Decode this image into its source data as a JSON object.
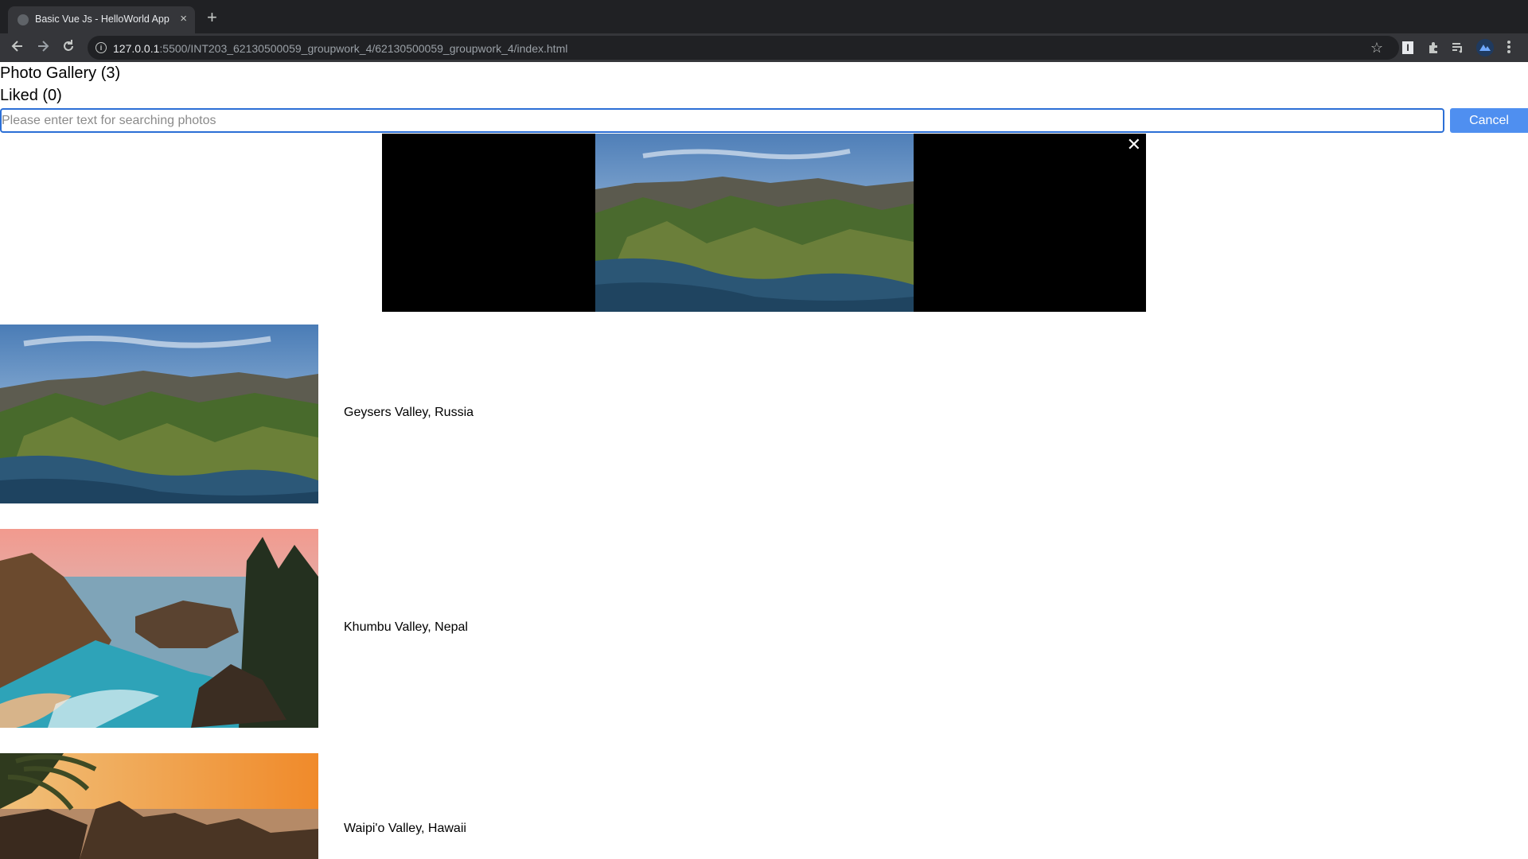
{
  "browser": {
    "tab_title": "Basic Vue Js - HelloWorld App",
    "tab_close": "×",
    "new_tab": "+",
    "url_host": "127.0.0.1",
    "url_path": ":5500/INT203_62130500059_groupwork_4/62130500059_groupwork_4/index.html",
    "icons": [
      "back-icon",
      "forward-icon",
      "reload-icon",
      "info-icon",
      "star-icon",
      "extension-icon",
      "puzzle-icon",
      "reading-list-icon",
      "avatar",
      "menu-icon"
    ]
  },
  "page": {
    "gallery_heading": "Photo Gallery (3)",
    "liked_heading": "Liked (0)",
    "search": {
      "value": "",
      "placeholder": "Please enter text for searching photos"
    },
    "cancel_label": "Cancel",
    "viewer": {
      "close_label": "✕",
      "photo": "big-sur-coast"
    },
    "photos": [
      {
        "caption": "Geysers Valley, Russia",
        "image": "big-sur-mountains"
      },
      {
        "caption": "Khumbu Valley, Nepal",
        "image": "coastal-waterfall-beach"
      },
      {
        "caption": "Waipi'o Valley, Hawaii",
        "image": "palm-sunset-coast"
      }
    ]
  }
}
